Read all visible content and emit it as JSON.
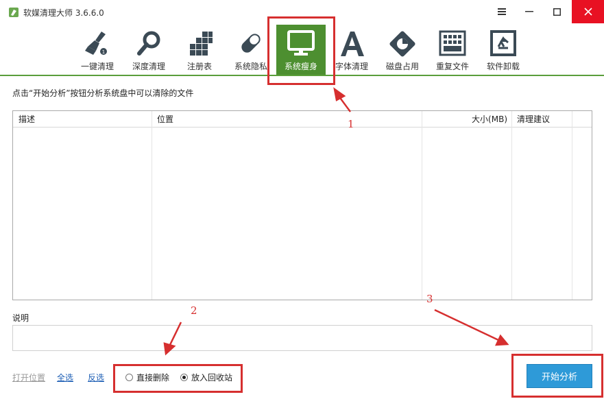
{
  "window": {
    "title": "软媒清理大师 3.6.6.0",
    "close_color": "#e81123"
  },
  "toolbar": {
    "accent": "#4d8f30",
    "items": [
      {
        "label": "一键清理",
        "icon": "broom-icon"
      },
      {
        "label": "深度清理",
        "icon": "magnifier-icon"
      },
      {
        "label": "注册表",
        "icon": "blocks-icon"
      },
      {
        "label": "系统隐私",
        "icon": "capsule-icon"
      },
      {
        "label": "系统瘦身",
        "icon": "monitor-icon",
        "active": true
      },
      {
        "label": "字体清理",
        "icon": "font-a-icon"
      },
      {
        "label": "磁盘占用",
        "icon": "disk-pie-icon"
      },
      {
        "label": "重复文件",
        "icon": "duplicate-grid-icon"
      },
      {
        "label": "软件卸载",
        "icon": "recycle-icon"
      }
    ]
  },
  "main": {
    "hint": "点击“开始分析”按钮分析系统盘中可以清除的文件",
    "table": {
      "columns": [
        "描述",
        "位置",
        "大小(MB)",
        "清理建议"
      ],
      "rows": []
    },
    "description_label": "说明",
    "description_value": ""
  },
  "footer": {
    "open_location": "打开位置",
    "select_all": "全选",
    "invert": "反选",
    "options": [
      {
        "label": "直接删除",
        "checked": false
      },
      {
        "label": "放入回收站",
        "checked": true
      }
    ],
    "start_button": "开始分析"
  },
  "annotations": {
    "color": "#d62f2f",
    "labels": [
      "1",
      "2",
      "3"
    ]
  }
}
